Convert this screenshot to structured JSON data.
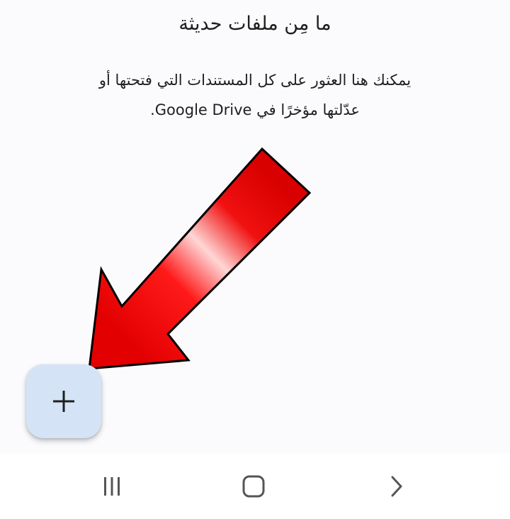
{
  "empty_state": {
    "title": "ما مِن ملفات حديثة",
    "body_line1": "يمكنك هنا العثور على كل المستندات التي فتحتها أو",
    "body_line2": "عدّلتها مؤخرًا في Google Drive."
  },
  "fab": {
    "icon": "plus-icon"
  },
  "annotation": {
    "icon": "red-arrow-icon",
    "color": "#e00000"
  },
  "navbar": {
    "recents_icon": "recent-apps-icon",
    "home_icon": "home-icon",
    "back_icon": "back-icon"
  },
  "colors": {
    "background": "#fbfbfe",
    "fab_background": "#d4e4f6",
    "text": "#1f1f1f",
    "nav_icon": "#555555"
  }
}
